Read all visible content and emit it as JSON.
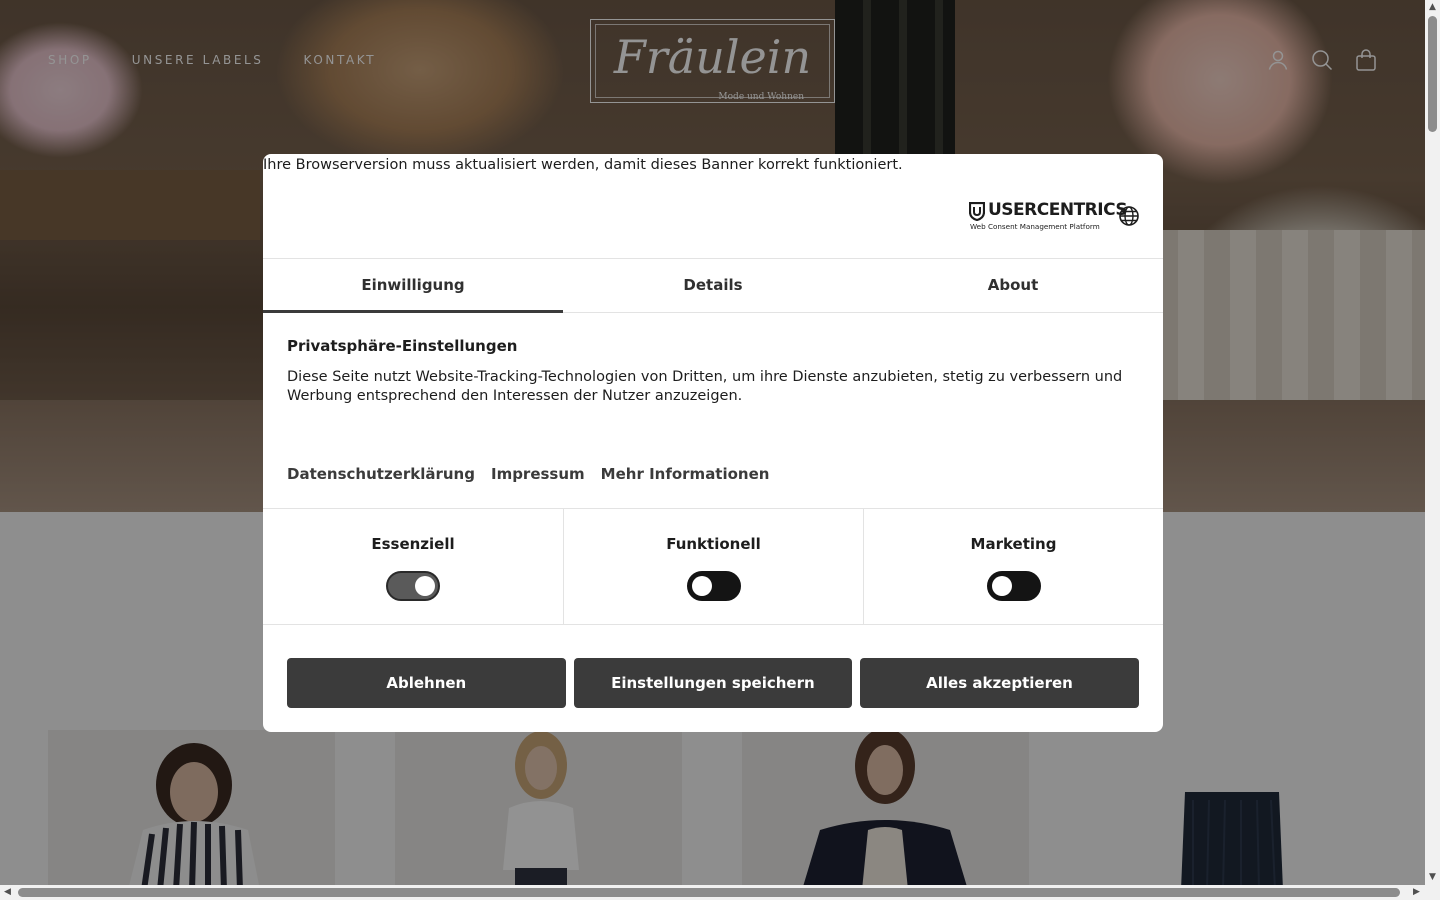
{
  "header": {
    "nav": [
      "SHOP",
      "UNSERE LABELS",
      "KONTAKT"
    ],
    "logo_title": "Fräulein",
    "logo_subtitle": "Mode und Wohnen",
    "icons": [
      "account-icon",
      "search-icon",
      "cart-icon"
    ]
  },
  "consent": {
    "browser_notice": "Ihre Browserversion muss aktualisiert werden, damit dieses Banner korrekt funktioniert.",
    "brand_name": "USERCENTRICS",
    "brand_sub": "Web Consent Management Platform",
    "language_icon": "globe-icon",
    "tabs": [
      "Einwilligung",
      "Details",
      "About"
    ],
    "active_tab": "Einwilligung",
    "title": "Privatsphäre-Einstellungen",
    "description": "Diese Seite nutzt Website-Tracking-Technologien von Dritten, um ihre Dienste anzubieten, stetig zu verbessern und Werbung entsprechend den Interessen der Nutzer anzuzeigen.",
    "links": [
      "Datenschutzerklärung",
      "Impressum",
      "Mehr Informationen"
    ],
    "categories": [
      {
        "label": "Essenziell",
        "checked": true
      },
      {
        "label": "Funktionell",
        "checked": false
      },
      {
        "label": "Marketing",
        "checked": false
      }
    ],
    "buttons": {
      "deny": "Ablehnen",
      "save": "Einstellungen speichern",
      "accept_all": "Alles akzeptieren"
    }
  },
  "colors": {
    "button_bg": "#3b3b3b",
    "overlay": "rgba(0,0,0,0.42)"
  }
}
